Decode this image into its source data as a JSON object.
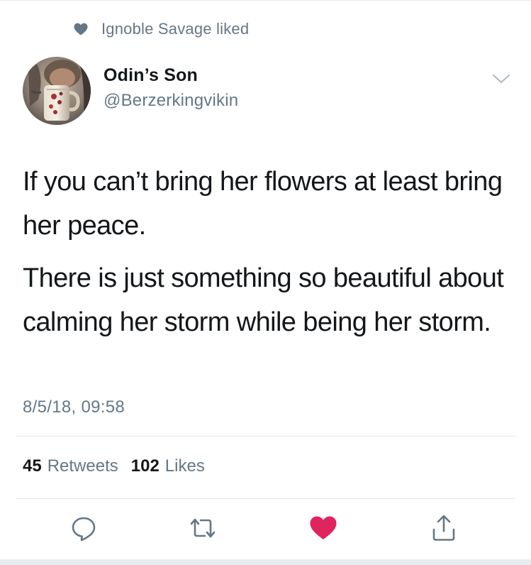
{
  "social_context": {
    "icon": "heart-icon",
    "text": "Ignoble Savage liked"
  },
  "author": {
    "display_name": "Odin’s Son",
    "handle": "@Berzerkingvikin",
    "avatar": "avatar-photo"
  },
  "menu": {
    "icon": "chevron-down-icon"
  },
  "tweet": {
    "paragraphs": [
      "If you can’t bring her flowers at least bring her peace.",
      "There is just something so beautiful about calming her storm while being her storm."
    ],
    "timestamp": "8/5/18, 09:58"
  },
  "stats": {
    "retweets_count": "45",
    "retweets_label": "Retweets",
    "likes_count": "102",
    "likes_label": "Likes"
  },
  "actions": {
    "reply_icon": "reply-icon",
    "retweet_icon": "retweet-icon",
    "like_icon": "heart-icon",
    "share_icon": "share-icon"
  },
  "colors": {
    "like_active": "#e0245e",
    "secondary_text": "#657786",
    "primary_text": "#14171a",
    "divider": "#e1e8ed"
  }
}
